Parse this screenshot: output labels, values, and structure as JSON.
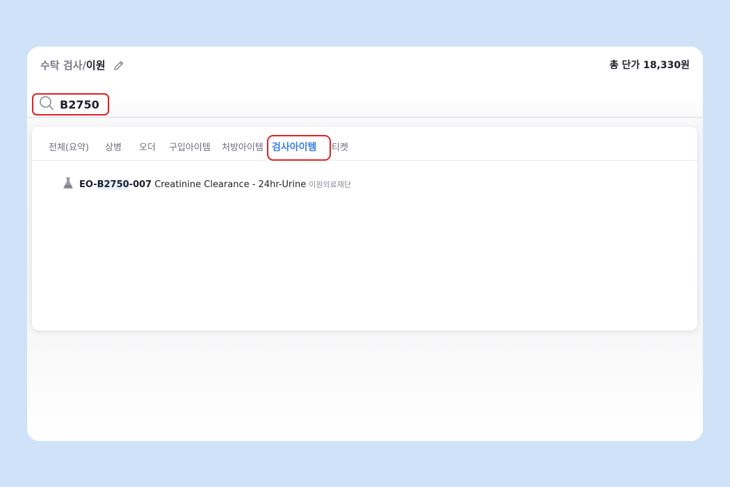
{
  "header": {
    "breadcrumb_parent": "수탁 검사",
    "breadcrumb_sep": "/",
    "breadcrumb_current": "이원",
    "total_price": "총 단가 18,330원"
  },
  "search": {
    "value": "B2750"
  },
  "tabs": [
    {
      "label": "전체(요약)"
    },
    {
      "label": "상병"
    },
    {
      "label": "오더"
    },
    {
      "label": "구입아이템"
    },
    {
      "label": "처방아이템"
    },
    {
      "label": "검사아이템",
      "active": true
    },
    {
      "label": "티켓"
    }
  ],
  "results": [
    {
      "code_prefix": "EO-",
      "code_match": "B2750",
      "code_suffix": "-007",
      "name": "Creatinine Clearance - 24hr-Urine",
      "vendor": "이원의료재단",
      "icon": "flask-icon"
    }
  ],
  "colors": {
    "accent": "#3f7fe0",
    "highlight_border": "#e02020",
    "page_bg": "#cfe2f8"
  }
}
